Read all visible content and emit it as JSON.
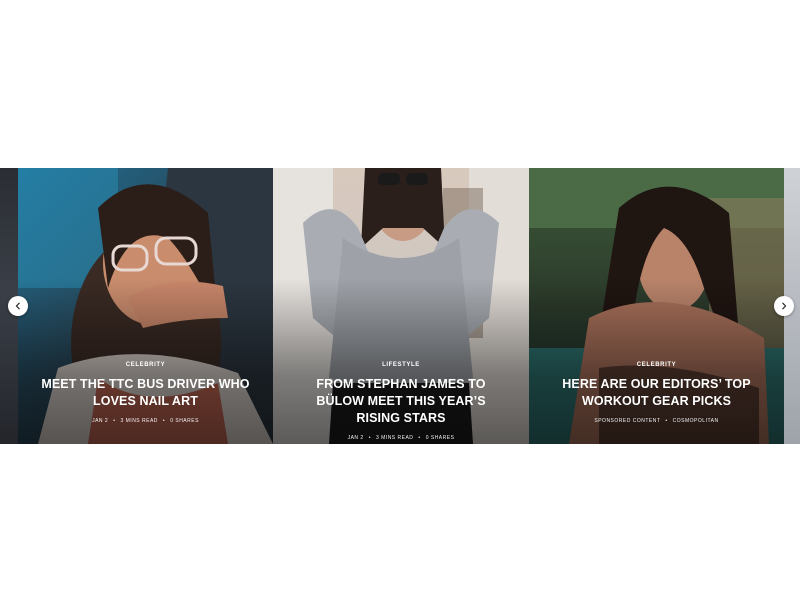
{
  "carousel": {
    "prev_icon": "chevron-left-icon",
    "next_icon": "chevron-right-icon",
    "slides": [
      {
        "category": "CELEBRITY",
        "title": "MEET THE TTC BUS DRIVER WHO LOVES NAIL ART",
        "meta": [
          "JAN 2",
          "3 MINS READ",
          "0 SHARES"
        ]
      },
      {
        "category": "LIFESTYLE",
        "title": "FROM STEPHAN JAMES TO BÜLOW MEET THIS YEAR’S RISING STARS",
        "meta": [
          "JAN 2",
          "3 MINS READ",
          "0 SHARES"
        ]
      },
      {
        "category": "CELEBRITY",
        "title": "HERE ARE OUR EDITORS’ TOP WORKOUT GEAR PICKS",
        "meta": [
          "SPONSORED CONTENT",
          "COSMOPOLITAN"
        ]
      }
    ]
  },
  "colors": {
    "overlay_text": "#ffffff",
    "nav_button_bg": "#ffffff"
  }
}
